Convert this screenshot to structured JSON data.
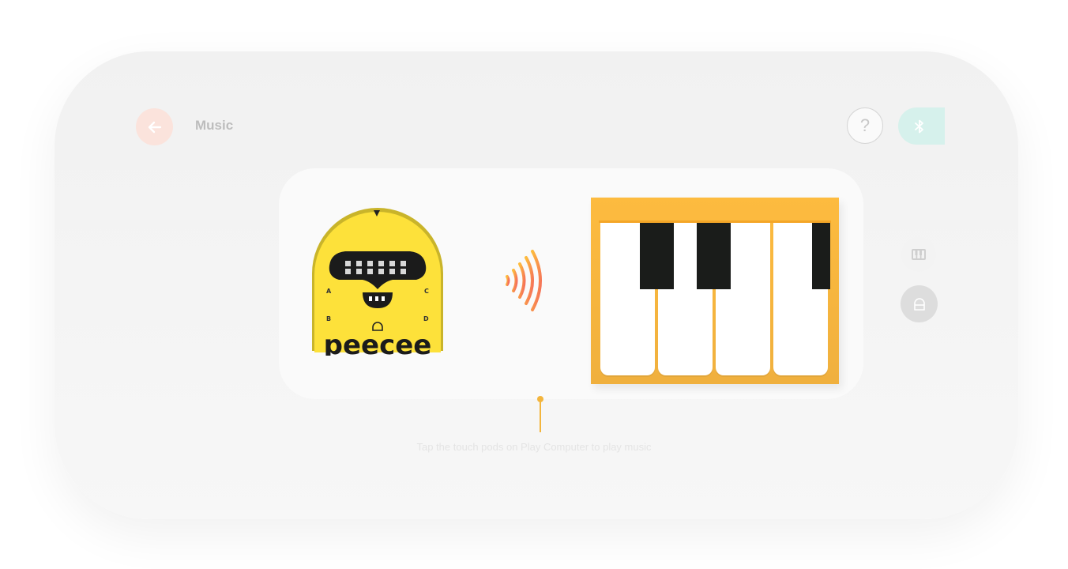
{
  "header": {
    "title": "Music",
    "help_label": "?"
  },
  "robot": {
    "brand_text": "peecee",
    "pad_labels": [
      "A",
      "C",
      "B",
      "D"
    ]
  },
  "hint": {
    "text": "Tap the touch pods on Play Computer to play music"
  },
  "colors": {
    "accent_orange": "#f3b53d",
    "back_button_bg": "#fbe3dc",
    "bluetooth_bg": "#d6f1ec",
    "robot_yellow": "#fde13a",
    "piano_frame": "#fdbb3f"
  },
  "icons": {
    "back": "arrow-left-icon",
    "help": "question-icon",
    "bluetooth": "bluetooth-icon",
    "piano": "piano-icon",
    "drum": "drum-icon",
    "sound": "sound-wave-icon"
  }
}
